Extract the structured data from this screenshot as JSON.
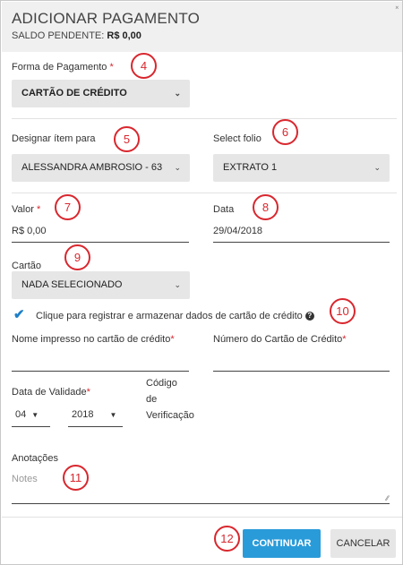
{
  "header": {
    "title": "ADICIONAR PAGAMENTO",
    "balance_label": "SALDO PENDENTE:",
    "balance_value": "R$ 0,00",
    "close_glyph": "˟"
  },
  "payment_method": {
    "label": "Forma de Pagamento",
    "required_mark": "*",
    "value": "CARTÃO DE CRÉDITO"
  },
  "assign_item": {
    "label": "Designar ítem para",
    "value": "ALESSANDRA AMBROSIO - 63"
  },
  "folio": {
    "label": "Select folio",
    "value": "EXTRATO 1"
  },
  "amount": {
    "label": "Valor",
    "required_mark": "*",
    "value": "R$ 0,00"
  },
  "date": {
    "label": "Data",
    "value": "29/04/2018"
  },
  "card": {
    "label": "Cartão",
    "value": "NADA SELECIONADO"
  },
  "save_card": {
    "checked": true,
    "label": "Clique para registrar e armazenar dados de cartão de crédito",
    "help_glyph": "?"
  },
  "card_name": {
    "label": "Nome impresso no cartão de crédito",
    "required_mark": "*"
  },
  "card_number": {
    "label": "Número do Cartão de Crédito",
    "required_mark": "*"
  },
  "expiry": {
    "label": "Data de Validade",
    "required_mark": "*",
    "month": "04",
    "year": "2018"
  },
  "cvv": {
    "label_line1": "Código",
    "label_line2": "de",
    "label_line3": "Verificação"
  },
  "notes": {
    "label": "Anotações",
    "placeholder": "Notes"
  },
  "buttons": {
    "continue": "CONTINUAR",
    "cancel": "CANCELAR"
  },
  "callouts": {
    "c4": "4",
    "c5": "5",
    "c6": "6",
    "c7": "7",
    "c8": "8",
    "c9": "9",
    "c10": "10",
    "c11": "11",
    "c12": "12"
  },
  "colors": {
    "primary": "#2a9bd9",
    "required": "#d9272e",
    "callout": "#d9272e",
    "check": "#1e7fc7"
  }
}
